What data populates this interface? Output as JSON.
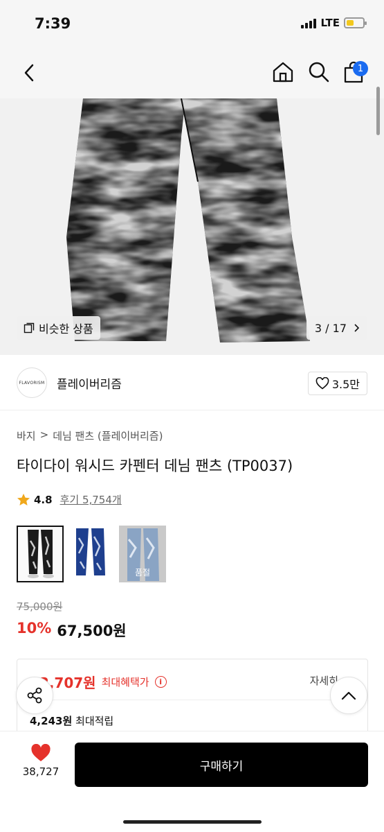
{
  "status_bar": {
    "time": "7:39",
    "network": "LTE",
    "battery_level": 0.45,
    "battery_color": "#f2c81d"
  },
  "nav": {
    "cart_count": "1",
    "badge_color": "#1a6bf0"
  },
  "gallery": {
    "similar_label": "비슷한 상품",
    "counter": "3 / 17"
  },
  "brand": {
    "logo_text": "FLAVORISM",
    "name": "플레이버리즘",
    "likes": "3.5만"
  },
  "breadcrumb": {
    "category": "바지",
    "separator": ">",
    "subcategory": "데님 팬츠 (플레이버리즘)"
  },
  "product": {
    "title": "타이다이 워시드 카펜터 데님 팬츠 (TP0037)",
    "rating": "4.8",
    "reviews": "후기 5,754개",
    "thumbnails": [
      {
        "name": "black",
        "soldout": ""
      },
      {
        "name": "blue",
        "soldout": ""
      },
      {
        "name": "light-blue",
        "soldout": "품절"
      }
    ],
    "original_price": "75,000원",
    "discount": "10%",
    "price": "67,500원"
  },
  "benefit": {
    "max_price": "62,707원",
    "max_label": "최대혜택가",
    "info_icon": "i",
    "detail_label": "자세히",
    "points_amount": "4,243원",
    "points_label": "최대적립"
  },
  "bottom_bar": {
    "like_count": "38,727",
    "buy_label": "구매하기",
    "heart_color": "#e5322b"
  },
  "colors": {
    "accent_red": "#e5322b",
    "buy_button": "#000000"
  }
}
